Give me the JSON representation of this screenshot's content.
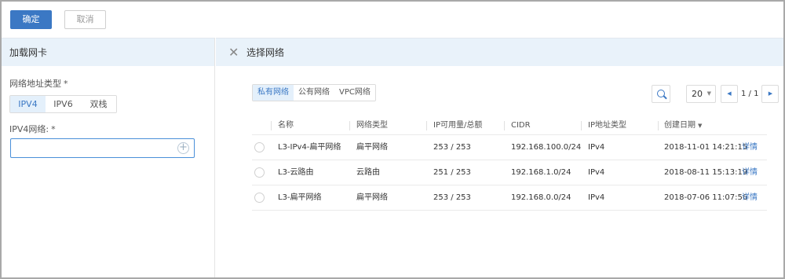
{
  "toolbar": {
    "ok_label": "确定",
    "cancel_label": "取消"
  },
  "left": {
    "title": "加载网卡",
    "addr_type_label": "网络地址类型",
    "required_mark": "*",
    "addr_types": [
      "IPV4",
      "IPV6",
      "双栈"
    ],
    "active_addr_type": "IPV4",
    "ipv4_label": "IPV4网络:",
    "ipv4_value": ""
  },
  "right": {
    "title": "选择网络",
    "tabs": [
      "私有网络",
      "公有网络",
      "VPC网络"
    ],
    "active_tab": "私有网络",
    "page_size": "20",
    "page_info": "1 / 1"
  },
  "table": {
    "headers": [
      "名称",
      "网络类型",
      "IP可用量/总额",
      "CIDR",
      "IP地址类型",
      "创建日期"
    ],
    "rows": [
      {
        "name": "L3-IPv4-扁平网络",
        "type": "扁平网络",
        "ip": "253 / 253",
        "cidr": "192.168.100.0/24",
        "ipType": "IPv4",
        "date": "2018-11-01 14:21:15",
        "action": "详情"
      },
      {
        "name": "L3-云路由",
        "type": "云路由",
        "ip": "251 / 253",
        "cidr": "192.168.1.0/24",
        "ipType": "IPv4",
        "date": "2018-08-11 15:13:19",
        "action": "详情"
      },
      {
        "name": "L3-扁平网络",
        "type": "扁平网络",
        "ip": "253 / 253",
        "cidr": "192.168.0.0/24",
        "ipType": "IPv4",
        "date": "2018-07-06 11:07:56",
        "action": "详情"
      }
    ]
  }
}
